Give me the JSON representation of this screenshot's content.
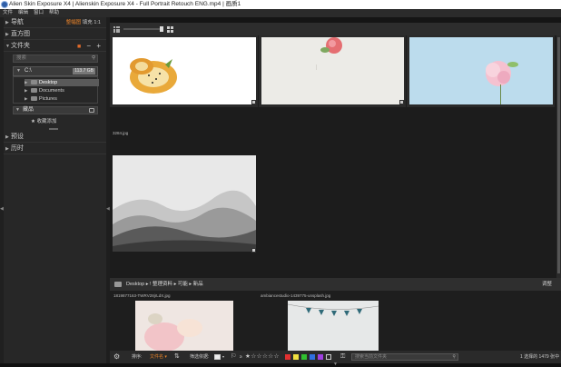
{
  "titlebar": {
    "title": "Alien Skin Exposure X4 | Alienskin Exposure X4 - Full Portrait Retouch ENG.mp4 | 画质1"
  },
  "menu": {
    "items": [
      "文件",
      "编辑",
      "窗口",
      "帮助"
    ]
  },
  "left_panel": {
    "nav": {
      "label": "导航",
      "fit": "整幅图",
      "fill": "填充",
      "ratio": "1:1"
    },
    "histogram": {
      "label": "直方图"
    },
    "folders": {
      "label": "文件夹",
      "search_placeholder": "搜索",
      "drive": "C:\\",
      "drive_size": "113.7 GB",
      "items": [
        {
          "label": "Desktop",
          "selected": true
        },
        {
          "label": "Documents"
        },
        {
          "label": "Pictures"
        }
      ],
      "favorites": "藏品",
      "add_favorite": "★ 收藏添加"
    },
    "presets": {
      "label": "预设"
    },
    "history": {
      "label": "历时"
    }
  },
  "thumbnails": [
    {
      "filename": "",
      "colors": [
        "#ffffff",
        "#f2b94a"
      ]
    },
    {
      "filename": "",
      "colors": [
        "#ecebe7",
        "#e56e72"
      ]
    },
    {
      "filename": "",
      "colors": [
        "#bcdced",
        "#f5c1d0"
      ]
    },
    {
      "filename": "3284.jpg",
      "colors": [
        "#e8e8e8",
        "#4a4a4a"
      ]
    }
  ],
  "pathbar": {
    "path": "Desktop ▸ ! 整理资料 ▸ 可能 ▸ 新品",
    "right": "调整"
  },
  "bottom_thumbs": [
    {
      "filename": "1819877163-TWRV28jrLdX.jpg"
    },
    {
      "filename": "ambiancestudio-1439775-unsplash.jpg"
    }
  ],
  "statusbar": {
    "sort_label": "排序:",
    "sort_value": "文件名 ▾",
    "filter_label": "筛选依据:",
    "search_placeholder": "搜索当前文件夹",
    "count": "1 选择的 1479 张中",
    "stars": "★☆☆☆☆☆",
    "colors": [
      "#e03030",
      "#f0e040",
      "#30c030",
      "#3070e0",
      "#a040e0"
    ]
  }
}
